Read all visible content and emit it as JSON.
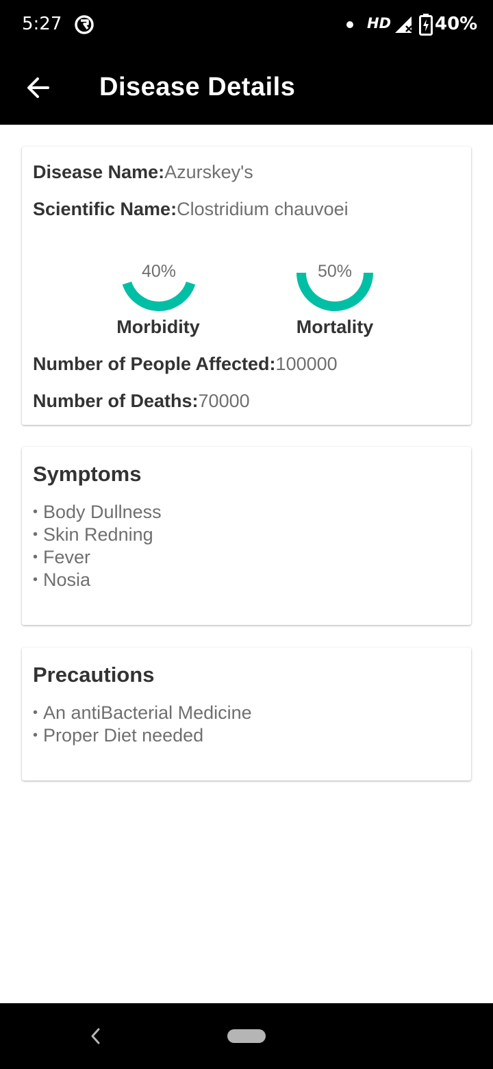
{
  "status_bar": {
    "time": "5:27",
    "network": "HD",
    "battery": "40%"
  },
  "app_bar": {
    "title": "Disease Details"
  },
  "disease": {
    "name_label": "Disease Name:",
    "name_value": "Azurskey's",
    "scientific_label": "Scientific Name:",
    "scientific_value": "Clostridium chauvoei",
    "affected_label": "Number of People Affected:",
    "affected_value": "100000",
    "deaths_label": "Number of Deaths:",
    "deaths_value": "70000"
  },
  "gauges": [
    {
      "label": "Morbidity",
      "percent_text": "40%",
      "percent": 40
    },
    {
      "label": "Mortality",
      "percent_text": "50%",
      "percent": 50
    }
  ],
  "gauge_color": "#00bfa5",
  "symptoms": {
    "title": "Symptoms",
    "items": [
      "Body Dullness",
      "Skin Redning",
      "Fever",
      "Nosia"
    ]
  },
  "precautions": {
    "title": "Precautions",
    "items": [
      "An antiBacterial Medicine",
      "Proper Diet needed"
    ]
  }
}
